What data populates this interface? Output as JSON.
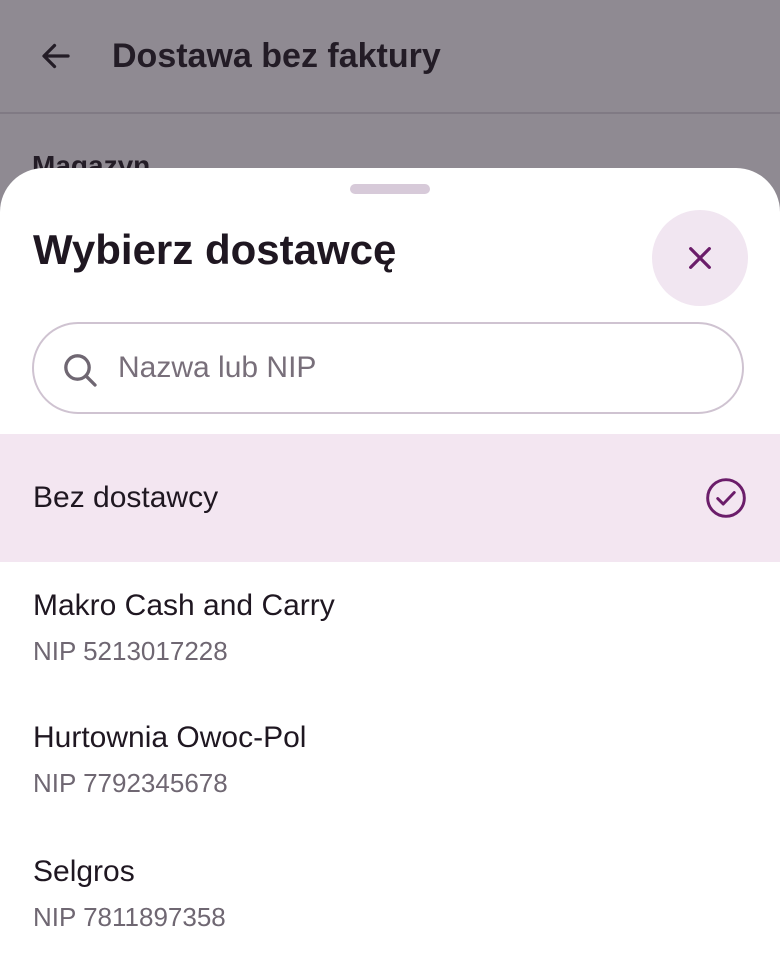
{
  "background": {
    "title": "Dostawa bez faktury",
    "section_label": "Magazyn"
  },
  "sheet": {
    "title": "Wybierz dostawcę",
    "search_placeholder": "Nazwa lub NIP",
    "search_value": "",
    "selected_option": "Bez dostawcy",
    "suppliers": [
      {
        "name": "Makro Cash and Carry",
        "nip": "NIP 5213017228"
      },
      {
        "name": "Hurtownia Owoc-Pol",
        "nip": "NIP 7792345678"
      },
      {
        "name": "Selgros",
        "nip": "NIP 7811897358"
      }
    ]
  },
  "icons": {
    "back": "arrow-left-icon",
    "close": "close-icon",
    "search": "search-icon",
    "check": "check-circle-icon"
  },
  "colors": {
    "accent": "#6b1d6a",
    "selected_bg": "#f3e6f1",
    "close_bg": "#f1e6f1",
    "scrim": "#8f8a92"
  }
}
